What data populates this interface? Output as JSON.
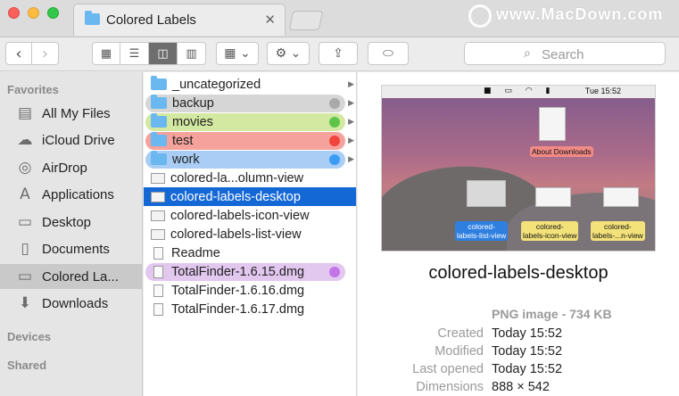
{
  "window": {
    "tab_title": "Colored Labels",
    "tab_close": "✕",
    "watermark": "www.MacDown.com"
  },
  "toolbar": {
    "back": "‹",
    "forward": "›",
    "view_icon": "▦",
    "view_list": "☰",
    "view_column": "◫",
    "view_coverflow": "▥",
    "arrange": "▦ ⌄",
    "action": "⚙ ⌄",
    "share": "⇪",
    "tags": "⬭",
    "search_placeholder": "Search",
    "search_icon": "search-icon"
  },
  "sidebar": {
    "favorites_heading": "Favorites",
    "items": [
      {
        "label": "All My Files",
        "icon": "▤"
      },
      {
        "label": "iCloud Drive",
        "icon": "☁"
      },
      {
        "label": "AirDrop",
        "icon": "◎"
      },
      {
        "label": "Applications",
        "icon": "A"
      },
      {
        "label": "Desktop",
        "icon": "▭"
      },
      {
        "label": "Documents",
        "icon": "▯"
      },
      {
        "label": "Colored La...",
        "icon": "▭"
      },
      {
        "label": "Downloads",
        "icon": "⬇"
      }
    ],
    "devices_heading": "Devices",
    "shared_heading": "Shared"
  },
  "files": [
    {
      "name": "_uncategorized",
      "kind": "folder",
      "label_color": "",
      "arrow": "▶"
    },
    {
      "name": "backup",
      "kind": "folder",
      "label_color": "#a9a9a9",
      "pill": "#d6d6d6",
      "arrow": "▶"
    },
    {
      "name": "movies",
      "kind": "folder",
      "label_color": "#5ec54a",
      "pill": "#d3e8a0",
      "arrow": "▶"
    },
    {
      "name": "test",
      "kind": "folder",
      "label_color": "#f2433d",
      "pill": "#f4a29b",
      "arrow": "▶"
    },
    {
      "name": "work",
      "kind": "folder",
      "label_color": "#3a9cf5",
      "pill": "#a9cdf4",
      "arrow": "▶"
    },
    {
      "name": "colored-la...olumn-view",
      "kind": "image",
      "label_color": "",
      "arrow": ""
    },
    {
      "name": "colored-labels-desktop",
      "kind": "image",
      "label_color": "",
      "arrow": "",
      "selected": true
    },
    {
      "name": "colored-labels-icon-view",
      "kind": "image",
      "label_color": "",
      "arrow": ""
    },
    {
      "name": "colored-labels-list-view",
      "kind": "image",
      "label_color": "",
      "arrow": ""
    },
    {
      "name": "Readme",
      "kind": "doc",
      "label_color": "",
      "arrow": ""
    },
    {
      "name": "TotalFinder-1.6.15.dmg",
      "kind": "doc",
      "label_color": "#c274e8",
      "pill": "#e2c7ef",
      "arrow": ""
    },
    {
      "name": "TotalFinder-1.6.16.dmg",
      "kind": "doc",
      "label_color": "",
      "arrow": ""
    },
    {
      "name": "TotalFinder-1.6.17.dmg",
      "kind": "doc",
      "label_color": "",
      "arrow": ""
    }
  ],
  "preview": {
    "menubar_time": "Tue 15:52",
    "thumb_labels": {
      "about": "About\nDownloads",
      "list": "colored-\nlabels-list-view",
      "icon": "colored-\nlabels-icon-view",
      "column": "colored-\nlabels-...n-view"
    },
    "title": "colored-labels-desktop",
    "kind": "PNG image - 734 KB",
    "meta": [
      {
        "key": "Created",
        "value": "Today 15:52"
      },
      {
        "key": "Modified",
        "value": "Today 15:52"
      },
      {
        "key": "Last opened",
        "value": "Today 15:52"
      },
      {
        "key": "Dimensions",
        "value": "888 × 542"
      }
    ]
  }
}
